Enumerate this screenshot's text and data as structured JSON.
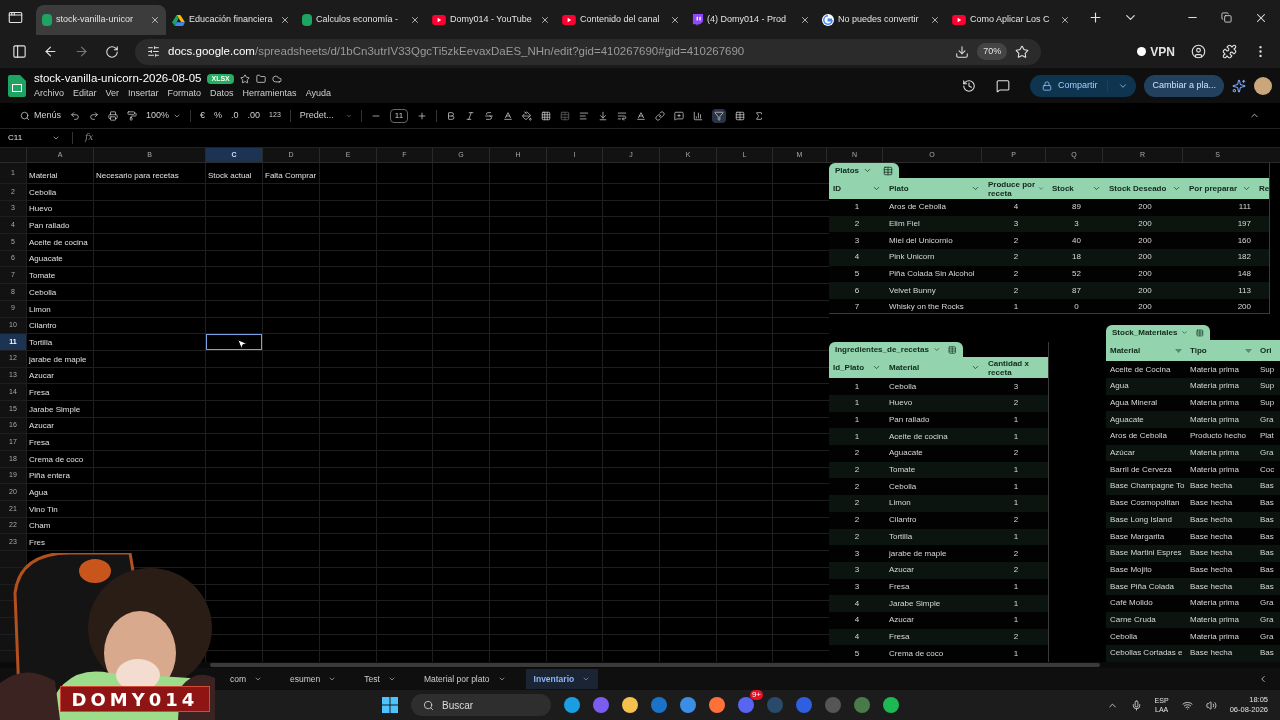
{
  "browser": {
    "tabs": [
      {
        "title": "stock-vanilla-unicor",
        "selected": true
      },
      {
        "title": "Educación financiera",
        "selected": false
      },
      {
        "title": "Calculos economía -",
        "selected": false
      },
      {
        "title": "Domy014 - YouTube",
        "selected": false
      },
      {
        "title": "Contenido del canal",
        "selected": false
      },
      {
        "title": "(4) Domy014 - Prod",
        "selected": false
      },
      {
        "title": "No puedes convertir",
        "selected": false
      },
      {
        "title": "Como Aplicar Los C",
        "selected": false
      }
    ],
    "url_host": "docs.google.com",
    "url_path": "/spreadsheets/d/1bCn3utrIV33QgcTi5zkEevaxDaES_NHn/edit?gid=410267690#gid=410267690",
    "zoom": "70%",
    "vpn": "VPN"
  },
  "sheets": {
    "title": "stock-vanilla-unicorn-2026-08-05",
    "badge": "XLSX",
    "menu": [
      "Archivo",
      "Editar",
      "Ver",
      "Insertar",
      "Formato",
      "Datos",
      "Herramientas",
      "Ayuda"
    ],
    "share": "Compartir",
    "switch": "Cambiar a pla..."
  },
  "toolbar": {
    "menus": "Menús",
    "zoom": "100%",
    "currency": "€",
    "percent": "%",
    "decimals_less": ".0",
    "decimals_more": ".00",
    "number_format": "123",
    "font": "Predet...",
    "font_size": "11"
  },
  "formula_bar": {
    "name_box": "C11",
    "fx": "fx"
  },
  "columns": [
    {
      "label": "A",
      "selected": false
    },
    {
      "label": "B",
      "selected": false
    },
    {
      "label": "C",
      "selected": true
    },
    {
      "label": "D",
      "selected": false
    },
    {
      "label": "E",
      "selected": false
    },
    {
      "label": "F",
      "selected": false
    },
    {
      "label": "G",
      "selected": false
    },
    {
      "label": "H",
      "selected": false
    },
    {
      "label": "I",
      "selected": false
    },
    {
      "label": "J",
      "selected": false
    },
    {
      "label": "K",
      "selected": false
    },
    {
      "label": "L",
      "selected": false
    },
    {
      "label": "M",
      "selected": false
    },
    {
      "label": "N",
      "selected": false
    },
    {
      "label": "O",
      "selected": false
    },
    {
      "label": "P",
      "selected": false
    },
    {
      "label": "Q",
      "selected": false
    },
    {
      "label": "R",
      "selected": false
    },
    {
      "label": "S",
      "selected": false
    }
  ],
  "rows": [
    {
      "number": "1",
      "cells": [
        "Material",
        "Necesario para recetas",
        "Stock actual",
        "Falta Comprar"
      ],
      "selected": false
    },
    {
      "number": "2",
      "cells": [
        "Cebolla"
      ],
      "selected": false
    },
    {
      "number": "3",
      "cells": [
        "Huevo"
      ],
      "selected": false
    },
    {
      "number": "4",
      "cells": [
        "Pan rallado"
      ],
      "selected": false
    },
    {
      "number": "5",
      "cells": [
        "Aceite de cocina"
      ],
      "selected": false
    },
    {
      "number": "6",
      "cells": [
        "Aguacate"
      ],
      "selected": false
    },
    {
      "number": "7",
      "cells": [
        "Tomate"
      ],
      "selected": false
    },
    {
      "number": "8",
      "cells": [
        "Cebolla"
      ],
      "selected": false
    },
    {
      "number": "9",
      "cells": [
        "Limon"
      ],
      "selected": false
    },
    {
      "number": "10",
      "cells": [
        "Cilantro"
      ],
      "selected": false
    },
    {
      "number": "11",
      "cells": [
        "Tortilla"
      ],
      "selected": true
    },
    {
      "number": "12",
      "cells": [
        "jarabe de maple"
      ],
      "selected": false
    },
    {
      "number": "13",
      "cells": [
        "Azucar"
      ],
      "selected": false
    },
    {
      "number": "14",
      "cells": [
        "Fresa"
      ],
      "selected": false
    },
    {
      "number": "15",
      "cells": [
        "Jarabe Simple"
      ],
      "selected": false
    },
    {
      "number": "16",
      "cells": [
        "Azucar"
      ],
      "selected": false
    },
    {
      "number": "17",
      "cells": [
        "Fresa"
      ],
      "selected": false
    },
    {
      "number": "18",
      "cells": [
        "Crema de coco"
      ],
      "selected": false
    },
    {
      "number": "19",
      "cells": [
        "Piña entera"
      ],
      "selected": false
    },
    {
      "number": "20",
      "cells": [
        "Agua"
      ],
      "selected": false
    },
    {
      "number": "21",
      "cells": [
        "Vino Tin"
      ],
      "selected": false
    },
    {
      "number": "22",
      "cells": [
        "Cham"
      ],
      "selected": false
    },
    {
      "number": "23",
      "cells": [
        "Fres"
      ],
      "selected": false
    }
  ],
  "platos": {
    "name": "Platos",
    "columns": [
      "ID",
      "Plato",
      "Produce por receta",
      "Stock",
      "Stock Deseado",
      "Por preparar",
      "Re"
    ],
    "rows": [
      [
        "1",
        "Aros de Cebolla",
        "4",
        "89",
        "200",
        "111"
      ],
      [
        "2",
        "Elim Fiel",
        "3",
        "3",
        "200",
        "197"
      ],
      [
        "3",
        "Miel del Unicornio",
        "2",
        "40",
        "200",
        "160"
      ],
      [
        "4",
        "Pink Unicorn",
        "2",
        "18",
        "200",
        "182"
      ],
      [
        "5",
        "Piña Colada Sin Alcohol",
        "2",
        "52",
        "200",
        "148"
      ],
      [
        "6",
        "Velvet Bunny",
        "2",
        "87",
        "200",
        "113"
      ],
      [
        "7",
        "Whisky on the Rocks",
        "1",
        "0",
        "200",
        "200"
      ]
    ]
  },
  "ingredientes": {
    "name": "Ingredientes_de_recetas",
    "columns": [
      "Id_Plato",
      "Material",
      "Cantidad x receta"
    ],
    "rows": [
      [
        "1",
        "Cebolla",
        "3"
      ],
      [
        "1",
        "Huevo",
        "2"
      ],
      [
        "1",
        "Pan rallado",
        "1"
      ],
      [
        "1",
        "Aceite de cocina",
        "1"
      ],
      [
        "2",
        "Aguacate",
        "2"
      ],
      [
        "2",
        "Tomate",
        "1"
      ],
      [
        "2",
        "Cebolla",
        "1"
      ],
      [
        "2",
        "Limon",
        "1"
      ],
      [
        "2",
        "Cilantro",
        "2"
      ],
      [
        "2",
        "Tortilla",
        "1"
      ],
      [
        "3",
        "jarabe de maple",
        "2"
      ],
      [
        "3",
        "Azucar",
        "2"
      ],
      [
        "3",
        "Fresa",
        "1"
      ],
      [
        "4",
        "Jarabe Simple",
        "1"
      ],
      [
        "4",
        "Azucar",
        "1"
      ],
      [
        "4",
        "Fresa",
        "2"
      ],
      [
        "5",
        "Crema de coco",
        "1"
      ]
    ]
  },
  "stock_materiales": {
    "name": "Stock_Materiales",
    "columns": [
      "Material",
      "Tipo",
      "Ori"
    ],
    "rows": [
      [
        "Aceite de Cocina",
        "Materia prima",
        "Sup"
      ],
      [
        "Agua",
        "Materia prima",
        "Sup"
      ],
      [
        "Agua Mineral",
        "Materia prima",
        "Sup"
      ],
      [
        "Aguacate",
        "Materia prima",
        "Gra"
      ],
      [
        "Aros de Cebolla",
        "Producto hecho",
        "Plat"
      ],
      [
        "Azúcar",
        "Materia prima",
        "Gra"
      ],
      [
        "Barril de Cerveza",
        "Materia prima",
        "Coc"
      ],
      [
        "Base Champagne To",
        "Base hecha",
        "Bas"
      ],
      [
        "Base Cosmopolitan",
        "Base hecha",
        "Bas"
      ],
      [
        "Base Long Island",
        "Base hecha",
        "Bas"
      ],
      [
        "Base Margarita",
        "Base hecha",
        "Bas"
      ],
      [
        "Base Martini Espres",
        "Base hecha",
        "Bas"
      ],
      [
        "Base Mojito",
        "Base hecha",
        "Bas"
      ],
      [
        "Base Piña Colada",
        "Base hecha",
        "Bas"
      ],
      [
        "Café Molido",
        "Materia prima",
        "Gra"
      ],
      [
        "Carne Cruda",
        "Materia prima",
        "Gra"
      ],
      [
        "Cebolla",
        "Materia prima",
        "Gra"
      ],
      [
        "Cebollas Cortadas e",
        "Base hecha",
        "Bas"
      ]
    ]
  },
  "sheet_tabs": [
    {
      "label": "com",
      "selected": false
    },
    {
      "label": "esumen",
      "selected": false
    },
    {
      "label": "Test",
      "selected": false
    },
    {
      "label": "Material por plato",
      "selected": false
    },
    {
      "label": "Inventario",
      "selected": true
    }
  ],
  "webcam": {
    "kind": "picture",
    "banner": "DOMY014"
  },
  "taskbar": {
    "search": "Buscar",
    "badge": "9+",
    "language": "ESP",
    "layout": "LAA",
    "time": "18:05",
    "date": "06-08-2026"
  }
}
